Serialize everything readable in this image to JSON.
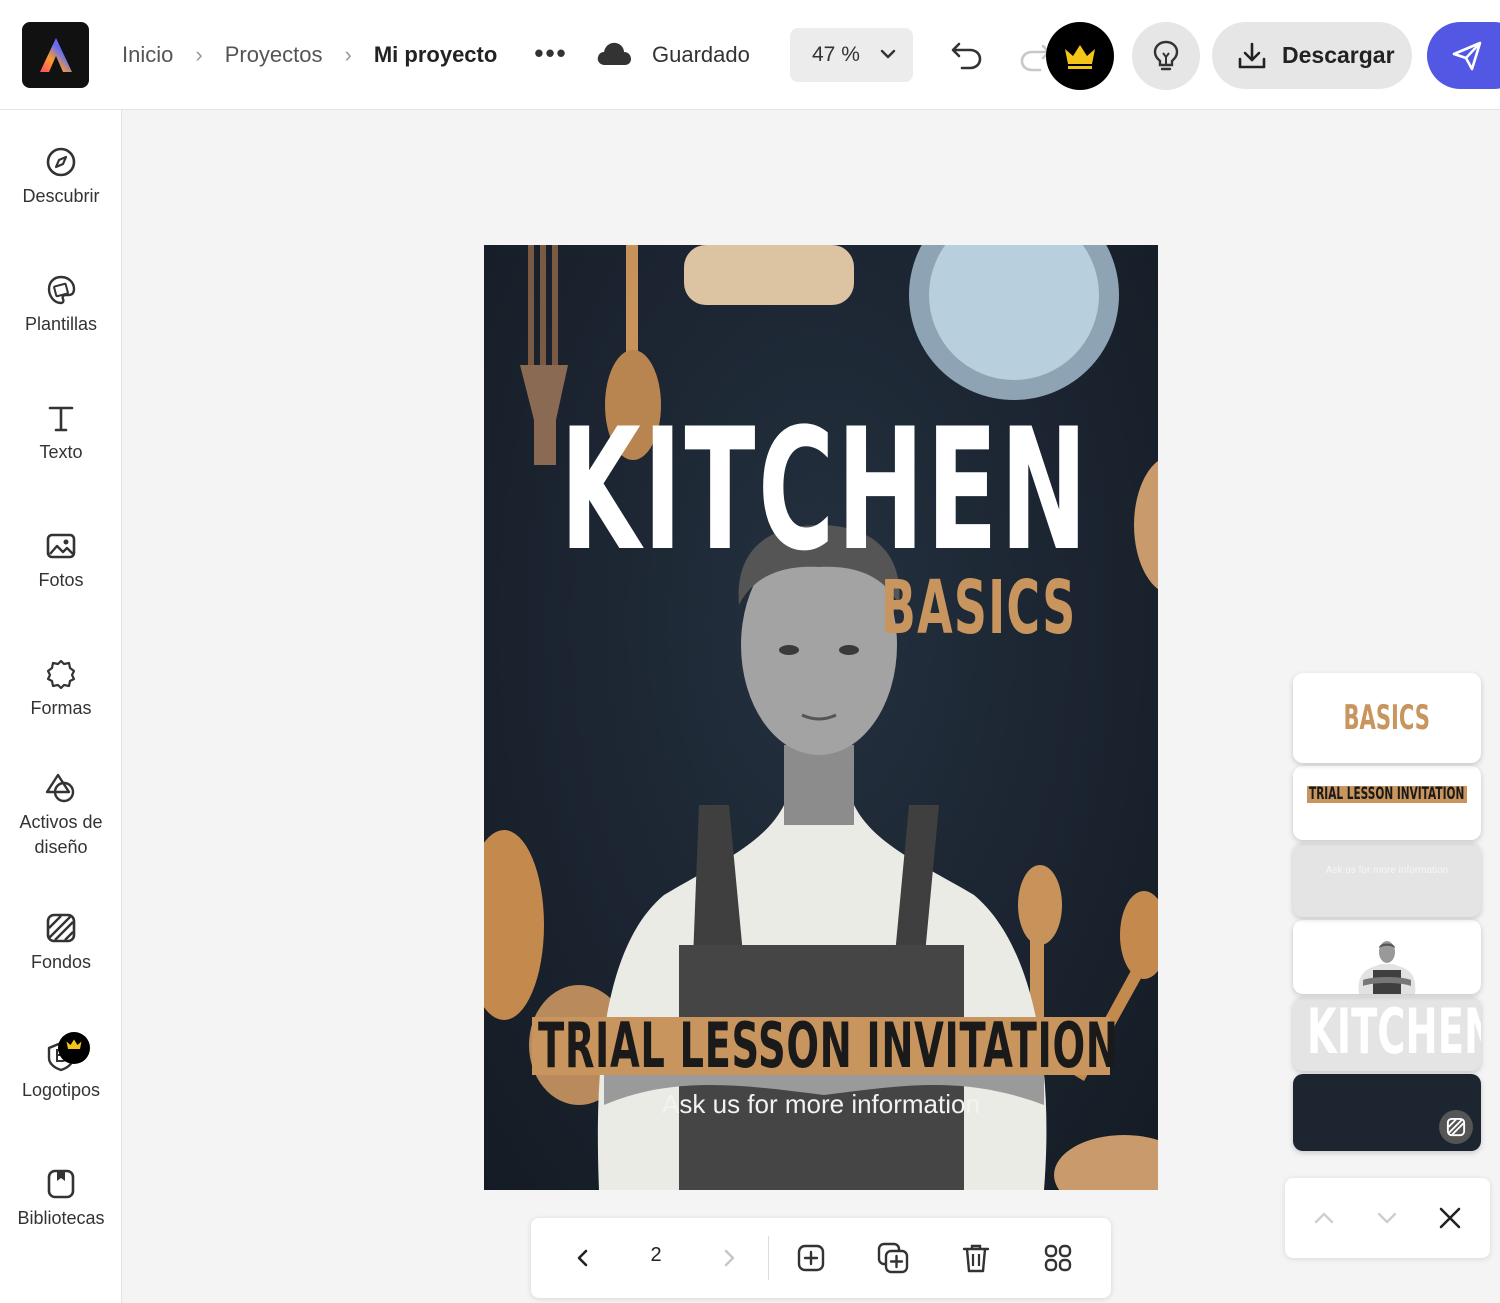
{
  "header": {
    "breadcrumbs": [
      "Inicio",
      "Proyectos",
      "Mi proyecto"
    ],
    "more_label": "•••",
    "save_status": "Guardado",
    "zoom": "47 %",
    "download_label": "Descargar"
  },
  "sidebar": {
    "items": [
      {
        "label": "Descubrir",
        "icon": "compass-icon"
      },
      {
        "label": "Plantillas",
        "icon": "templates-icon"
      },
      {
        "label": "Texto",
        "icon": "text-icon"
      },
      {
        "label": "Fotos",
        "icon": "photo-icon"
      },
      {
        "label": "Formas",
        "icon": "shapes-icon"
      },
      {
        "label": "Activos de diseño",
        "icon": "design-assets-icon"
      },
      {
        "label": "Fondos",
        "icon": "backgrounds-icon"
      },
      {
        "label": "Logotipos",
        "icon": "brand-logo-icon"
      },
      {
        "label": "Bibliotecas",
        "icon": "libraries-icon"
      }
    ]
  },
  "design": {
    "title": "KITCHEN",
    "subtitle": "BASICS",
    "banner": "TRIAL LESSON INVITATION",
    "info": "Ask us for more information"
  },
  "pagination": {
    "current_page": "2"
  },
  "layers": {
    "basics": "BASICS",
    "trial": "TRIAL LESSON INVITATION",
    "info": "Ask us for more information",
    "kitchen": "KITCHEN"
  },
  "colors": {
    "accent": "#c9955e",
    "share_button": "#5258e4",
    "design_background": "#1b2430",
    "premium_crown": "#f5c518"
  }
}
